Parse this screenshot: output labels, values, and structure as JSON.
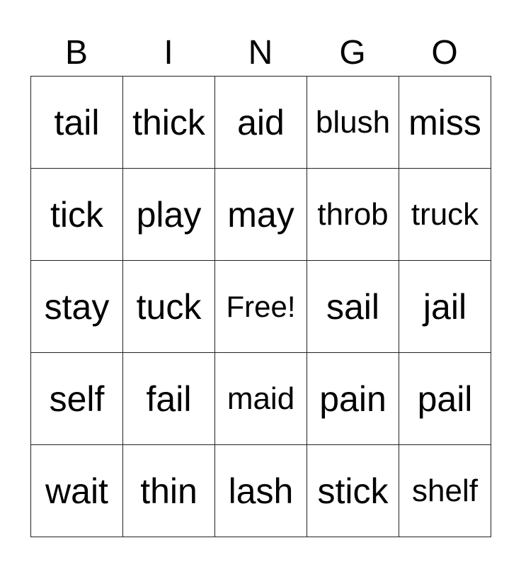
{
  "header": [
    "B",
    "I",
    "N",
    "G",
    "O"
  ],
  "rows": [
    [
      "tail",
      "thick",
      "aid",
      "blush",
      "miss"
    ],
    [
      "tick",
      "play",
      "may",
      "throb",
      "truck"
    ],
    [
      "stay",
      "tuck",
      "Free!",
      "sail",
      "jail"
    ],
    [
      "self",
      "fail",
      "maid",
      "pain",
      "pail"
    ],
    [
      "wait",
      "thin",
      "lash",
      "stick",
      "shelf"
    ]
  ]
}
